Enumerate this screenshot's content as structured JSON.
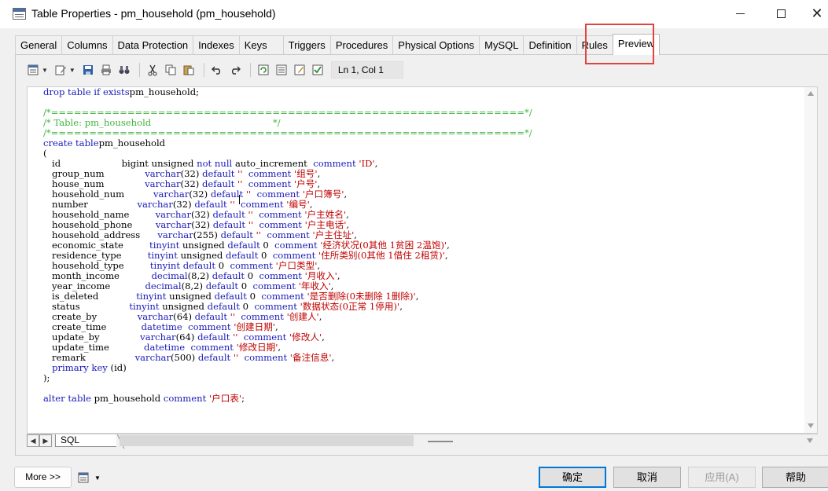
{
  "window": {
    "title": "Table Properties - pm_household (pm_household)"
  },
  "tabs": [
    {
      "label": "General"
    },
    {
      "label": "Columns"
    },
    {
      "label": "Data Protection"
    },
    {
      "label": "Indexes"
    },
    {
      "label": "Keys"
    },
    {
      "label": "Triggers"
    },
    {
      "label": "Procedures"
    },
    {
      "label": "Physical Options"
    },
    {
      "label": "MySQL"
    },
    {
      "label": "Definition"
    },
    {
      "label": "Rules"
    },
    {
      "label": "Preview",
      "active": true
    }
  ],
  "toolbar": {
    "cursor_position": "Ln 1, Col 1"
  },
  "editor": {
    "lines": [
      [
        [
          "kw",
          "drop table if exists"
        ],
        [
          "",
          "pm_household;"
        ]
      ],
      [],
      [
        [
          "cm",
          "/*==============================================================*/"
        ]
      ],
      [
        [
          "cm",
          "/* Table: pm_household                                          */"
        ]
      ],
      [
        [
          "cm",
          "/*==============================================================*/"
        ]
      ],
      [
        [
          "kw",
          "create table"
        ],
        [
          "",
          "pm_household"
        ]
      ],
      [
        [
          "",
          "("
        ]
      ],
      [
        [
          "",
          "   id                     bigint unsigned "
        ],
        [
          "kw",
          "not null"
        ],
        [
          "",
          " auto_increment  "
        ],
        [
          "kw",
          "comment"
        ],
        [
          "",
          " "
        ],
        [
          "str",
          "'ID'"
        ],
        [
          "",
          ","
        ]
      ],
      [
        [
          "",
          "   group_num              "
        ],
        [
          "kw",
          "varchar"
        ],
        [
          "",
          "(32) "
        ],
        [
          "kw",
          "default"
        ],
        [
          "",
          " "
        ],
        [
          "str",
          "''"
        ],
        [
          "",
          "  "
        ],
        [
          "kw",
          "comment"
        ],
        [
          "",
          " "
        ],
        [
          "str",
          "'组号'"
        ],
        [
          "",
          ","
        ]
      ],
      [
        [
          "",
          "   house_num              "
        ],
        [
          "kw",
          "varchar"
        ],
        [
          "",
          "(32) "
        ],
        [
          "kw",
          "default"
        ],
        [
          "",
          " "
        ],
        [
          "str",
          "''"
        ],
        [
          "",
          "  "
        ],
        [
          "kw",
          "comment"
        ],
        [
          "",
          " "
        ],
        [
          "str",
          "'户号'"
        ],
        [
          "",
          ","
        ]
      ],
      [
        [
          "",
          "   household_num          "
        ],
        [
          "kw",
          "varchar"
        ],
        [
          "",
          "(32) "
        ],
        [
          "kw",
          "default"
        ],
        [
          "",
          " "
        ],
        [
          "str",
          "''"
        ],
        [
          "",
          "  "
        ],
        [
          "kw",
          "comment"
        ],
        [
          "",
          " "
        ],
        [
          "str",
          "'户口簿号'"
        ],
        [
          "",
          ","
        ]
      ],
      [
        [
          "",
          "   number                 "
        ],
        [
          "kw",
          "varchar"
        ],
        [
          "",
          "(32) "
        ],
        [
          "kw",
          "default"
        ],
        [
          "",
          " "
        ],
        [
          "str",
          "''"
        ],
        [
          "",
          "  "
        ],
        [
          "kw",
          "comment"
        ],
        [
          "",
          " "
        ],
        [
          "str",
          "'编号'"
        ],
        [
          "",
          ","
        ]
      ],
      [
        [
          "",
          "   household_name         "
        ],
        [
          "kw",
          "varchar"
        ],
        [
          "",
          "(32) "
        ],
        [
          "kw",
          "default"
        ],
        [
          "",
          " "
        ],
        [
          "str",
          "''"
        ],
        [
          "",
          "  "
        ],
        [
          "kw",
          "comment"
        ],
        [
          "",
          " "
        ],
        [
          "str",
          "'户主姓名'"
        ],
        [
          "",
          ","
        ]
      ],
      [
        [
          "",
          "   household_phone        "
        ],
        [
          "kw",
          "varchar"
        ],
        [
          "",
          "(32) "
        ],
        [
          "kw",
          "default"
        ],
        [
          "",
          " "
        ],
        [
          "str",
          "''"
        ],
        [
          "",
          "  "
        ],
        [
          "kw",
          "comment"
        ],
        [
          "",
          " "
        ],
        [
          "str",
          "'户主电话'"
        ],
        [
          "",
          ","
        ]
      ],
      [
        [
          "",
          "   household_address      "
        ],
        [
          "kw",
          "varchar"
        ],
        [
          "",
          "(255) "
        ],
        [
          "kw",
          "default"
        ],
        [
          "",
          " "
        ],
        [
          "str",
          "''"
        ],
        [
          "",
          "  "
        ],
        [
          "kw",
          "comment"
        ],
        [
          "",
          " "
        ],
        [
          "str",
          "'户主住址'"
        ],
        [
          "",
          ","
        ]
      ],
      [
        [
          "",
          "   economic_state         "
        ],
        [
          "kw",
          "tinyint"
        ],
        [
          "",
          " unsigned "
        ],
        [
          "kw",
          "default"
        ],
        [
          "",
          " 0  "
        ],
        [
          "kw",
          "comment"
        ],
        [
          "",
          " "
        ],
        [
          "str",
          "'经济状况(0其他 1贫困 2温饱)'"
        ],
        [
          "",
          ","
        ]
      ],
      [
        [
          "",
          "   residence_type         "
        ],
        [
          "kw",
          "tinyint"
        ],
        [
          "",
          " unsigned "
        ],
        [
          "kw",
          "default"
        ],
        [
          "",
          " 0  "
        ],
        [
          "kw",
          "comment"
        ],
        [
          "",
          " "
        ],
        [
          "str",
          "'住所类别(0其他 1借住 2租赁)'"
        ],
        [
          "",
          ","
        ]
      ],
      [
        [
          "",
          "   household_type         "
        ],
        [
          "kw",
          "tinyint"
        ],
        [
          "",
          " "
        ],
        [
          "kw",
          "default"
        ],
        [
          "",
          " 0  "
        ],
        [
          "kw",
          "comment"
        ],
        [
          "",
          " "
        ],
        [
          "str",
          "'户口类型'"
        ],
        [
          "",
          ","
        ]
      ],
      [
        [
          "",
          "   month_income           "
        ],
        [
          "kw",
          "decimal"
        ],
        [
          "",
          "(8,2) "
        ],
        [
          "kw",
          "default"
        ],
        [
          "",
          " 0  "
        ],
        [
          "kw",
          "comment"
        ],
        [
          "",
          " "
        ],
        [
          "str",
          "'月收入'"
        ],
        [
          "",
          ","
        ]
      ],
      [
        [
          "",
          "   year_income            "
        ],
        [
          "kw",
          "decimal"
        ],
        [
          "",
          "(8,2) "
        ],
        [
          "kw",
          "default"
        ],
        [
          "",
          " 0  "
        ],
        [
          "kw",
          "comment"
        ],
        [
          "",
          " "
        ],
        [
          "str",
          "'年收入'"
        ],
        [
          "",
          ","
        ]
      ],
      [
        [
          "",
          "   is_deleted             "
        ],
        [
          "kw",
          "tinyint"
        ],
        [
          "",
          " unsigned "
        ],
        [
          "kw",
          "default"
        ],
        [
          "",
          " 0  "
        ],
        [
          "kw",
          "comment"
        ],
        [
          "",
          " "
        ],
        [
          "str",
          "'是否删除(0未删除 1删除)'"
        ],
        [
          "",
          ","
        ]
      ],
      [
        [
          "",
          "   status                 "
        ],
        [
          "kw",
          "tinyint"
        ],
        [
          "",
          " unsigned "
        ],
        [
          "kw",
          "default"
        ],
        [
          "",
          " 0  "
        ],
        [
          "kw",
          "comment"
        ],
        [
          "",
          " "
        ],
        [
          "str",
          "'数据状态(0正常 1停用)'"
        ],
        [
          "",
          ","
        ]
      ],
      [
        [
          "",
          "   create_by              "
        ],
        [
          "kw",
          "varchar"
        ],
        [
          "",
          "(64) "
        ],
        [
          "kw",
          "default"
        ],
        [
          "",
          " "
        ],
        [
          "str",
          "''"
        ],
        [
          "",
          "  "
        ],
        [
          "kw",
          "comment"
        ],
        [
          "",
          " "
        ],
        [
          "str",
          "'创建人'"
        ],
        [
          "",
          ","
        ]
      ],
      [
        [
          "",
          "   create_time            "
        ],
        [
          "kw",
          "datetime"
        ],
        [
          "",
          "  "
        ],
        [
          "kw",
          "comment"
        ],
        [
          "",
          " "
        ],
        [
          "str",
          "'创建日期'"
        ],
        [
          "",
          ","
        ]
      ],
      [
        [
          "",
          "   update_by              "
        ],
        [
          "kw",
          "varchar"
        ],
        [
          "",
          "(64) "
        ],
        [
          "kw",
          "default"
        ],
        [
          "",
          " "
        ],
        [
          "str",
          "''"
        ],
        [
          "",
          "  "
        ],
        [
          "kw",
          "comment"
        ],
        [
          "",
          " "
        ],
        [
          "str",
          "'修改人'"
        ],
        [
          "",
          ","
        ]
      ],
      [
        [
          "",
          "   update_time            "
        ],
        [
          "kw",
          "datetime"
        ],
        [
          "",
          "  "
        ],
        [
          "kw",
          "comment"
        ],
        [
          "",
          " "
        ],
        [
          "str",
          "'修改日期'"
        ],
        [
          "",
          ","
        ]
      ],
      [
        [
          "",
          "   remark                 "
        ],
        [
          "kw",
          "varchar"
        ],
        [
          "",
          "(500) "
        ],
        [
          "kw",
          "default"
        ],
        [
          "",
          " "
        ],
        [
          "str",
          "''"
        ],
        [
          "",
          "  "
        ],
        [
          "kw",
          "comment"
        ],
        [
          "",
          " "
        ],
        [
          "str",
          "'备注信息'"
        ],
        [
          "",
          ","
        ]
      ],
      [
        [
          "",
          "   "
        ],
        [
          "kw",
          "primary key"
        ],
        [
          "",
          " (id)"
        ]
      ],
      [
        [
          "",
          ");"
        ]
      ],
      [],
      [
        [
          "kw",
          "alter table"
        ],
        [
          "",
          " pm_household "
        ],
        [
          "kw",
          "comment"
        ],
        [
          "",
          " "
        ],
        [
          "str",
          "'户口表'"
        ],
        [
          "",
          ";"
        ]
      ]
    ]
  },
  "sheet_tabs": {
    "active_label": "SQL"
  },
  "buttons": {
    "more": "More >>",
    "ok": "确定",
    "cancel": "取消",
    "apply": "应用(A)",
    "help": "帮助"
  },
  "colors": {
    "keyword": "#1a1ab8",
    "string": "#c00000",
    "comment": "#3cb43c",
    "highlight": "#e0443e"
  }
}
